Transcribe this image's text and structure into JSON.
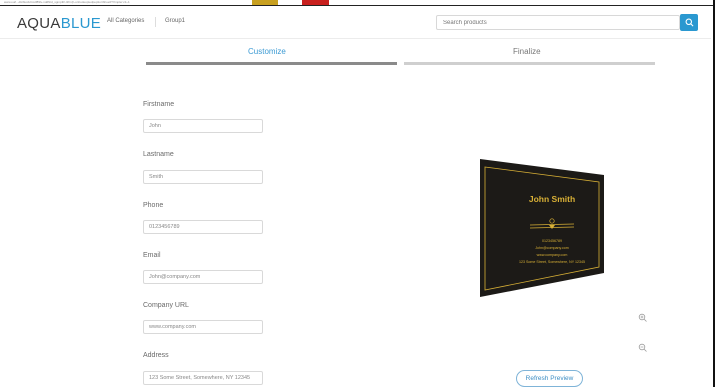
{
  "browser": {
    "url_fragment": "www.ourl...disStockCsHf89iv-nddNid_sgmptR-r2fm(f~urlcodeoptedpeptionShoe0TXmpler:cit~1",
    "tab_colors": [
      "#c8a020",
      "#c8201e"
    ]
  },
  "header": {
    "logo_main": "AQUA",
    "logo_accent": "BLUE",
    "nav": [
      "All Categories",
      "Group1"
    ],
    "search_placeholder": "Search products",
    "search_icon": "search-icon",
    "accent_color": "#2a98d0"
  },
  "steps": [
    {
      "label": "Customize",
      "active": true
    },
    {
      "label": "Finalize",
      "active": false
    }
  ],
  "form": {
    "fields": [
      {
        "label": "Firstname",
        "value": "John"
      },
      {
        "label": "Lastname",
        "value": "Smith"
      },
      {
        "label": "Phone",
        "value": "0123456789"
      },
      {
        "label": "Email",
        "value": "John@company.com"
      },
      {
        "label": "Company URL",
        "value": "www.company.com"
      },
      {
        "label": "Address",
        "value": "123 Some Street, Somewhere, NY 12345"
      }
    ]
  },
  "preview": {
    "card_name": "John Smith",
    "card_phone": "0123456789",
    "card_email": "John@company.com",
    "card_url": "www.company.com",
    "card_address": "123 Some Street, Somewhere, NY 12345",
    "card_bg": "#1c1a17",
    "card_accent": "#d8b036",
    "zoom_in_icon": "zoom-in-icon",
    "zoom_out_icon": "zoom-out-icon",
    "refresh_label": "Refresh Preview"
  }
}
